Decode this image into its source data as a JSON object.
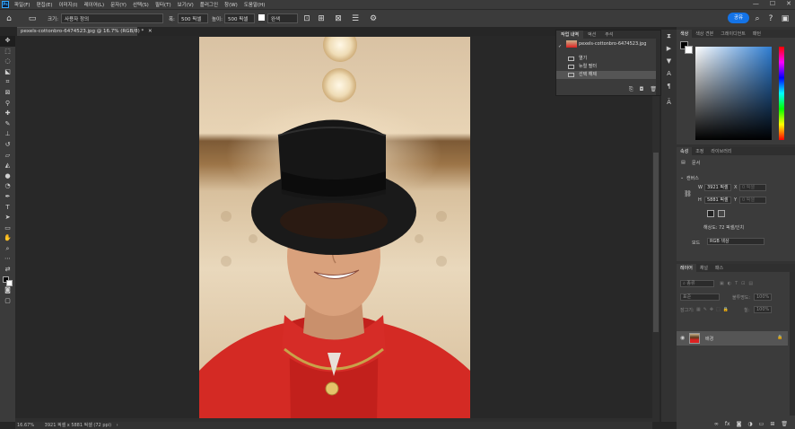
{
  "menu": {
    "logo": "Ps",
    "items": [
      "파일(F)",
      "편집(E)",
      "이미지(I)",
      "레이어(L)",
      "문자(Y)",
      "선택(S)",
      "필터(T)",
      "보기(V)",
      "플러그인",
      "창(W)",
      "도움말(H)"
    ],
    "window_controls": [
      "—",
      "☐",
      "✕"
    ]
  },
  "options": {
    "size_label": "크기:",
    "size_value": "사용자 정의",
    "width_label": "폭:",
    "width_value": "500 픽셀",
    "height_label": "높이:",
    "height_value": "500 픽셀",
    "color_mode": "완색",
    "share_label": "공유"
  },
  "document": {
    "tab_title": "pexels-cottonbro-6474523.jpg @ 16.7% (RGB/8) *",
    "tab_close": "✕"
  },
  "status": {
    "zoom": "16.67%",
    "info": "3921 픽셀 x 5881 픽셀 (72 ppi)",
    "arrow": "›"
  },
  "history_panel": {
    "tabs": [
      "작업 내역",
      "액션",
      "주석"
    ],
    "snapshot": "pexels-cottonbro-6474523.jpg",
    "states": [
      "열기",
      "뉴럴 필터",
      "선택 해제"
    ]
  },
  "color_panel": {
    "tabs": [
      "색상",
      "색상 견본",
      "그레이디언트",
      "패턴"
    ]
  },
  "properties_panel": {
    "tabs": [
      "속성",
      "조정",
      "라이브러리"
    ],
    "doc_label": "문서",
    "canvas_section": "캔버스",
    "w_label": "W",
    "w_value": "3921 픽셀",
    "x_label": "X",
    "x_value": "0 픽셀",
    "h_label": "H",
    "h_value": "5881 픽셀",
    "y_label": "Y",
    "y_value": "0 픽셀",
    "resolution": "해상도: 72 픽셀/인치",
    "mode_label": "모드",
    "mode_value": "RGB 색상"
  },
  "layers_panel": {
    "tabs": [
      "레이어",
      "채널",
      "패스"
    ],
    "filter_placeholder": "종류",
    "blend_mode": "표준",
    "opacity_label": "불투명도:",
    "opacity_value": "100%",
    "lock_label": "잠그기:",
    "fill_label": "칠:",
    "fill_value": "100%",
    "layer_name": "배경"
  },
  "colors": {
    "accent": "#1473e6",
    "panel_bg": "#3b3b3b",
    "workspace": "#262626",
    "jacket_red": "#d42a24"
  }
}
